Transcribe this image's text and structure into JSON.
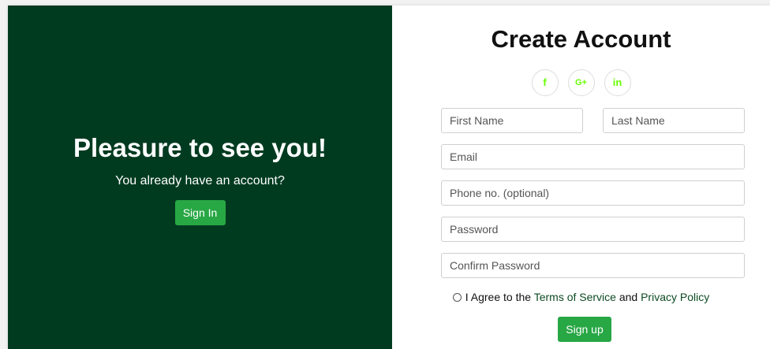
{
  "left_panel": {
    "title": "Pleasure to see you!",
    "subtitle": "You already have an account?",
    "signin_label": "Sign In"
  },
  "right_panel": {
    "title": "Create Account",
    "social": [
      {
        "icon": "facebook-icon",
        "glyph": "f"
      },
      {
        "icon": "google-plus-icon",
        "glyph": "G+"
      },
      {
        "icon": "linkedin-icon",
        "glyph": "in"
      }
    ],
    "fields": {
      "first_name": {
        "placeholder": "First Name",
        "value": ""
      },
      "last_name": {
        "placeholder": "Last Name",
        "value": ""
      },
      "email": {
        "placeholder": "Email",
        "value": ""
      },
      "phone": {
        "placeholder": "Phone no. (optional)",
        "value": ""
      },
      "password": {
        "placeholder": "Password",
        "value": ""
      },
      "confirm_password": {
        "placeholder": "Confirm Password",
        "value": ""
      }
    },
    "agree": {
      "prefix": "I Agree to the",
      "terms_link": "Terms of Service",
      "and_text": "and",
      "privacy_link": "Privacy Policy"
    },
    "signup_label": "Sign up"
  },
  "colors": {
    "left_panel_bg": "#003b20",
    "button_green": "#28a745",
    "social_icon": "#66ff00",
    "link": "#0d4a22"
  }
}
